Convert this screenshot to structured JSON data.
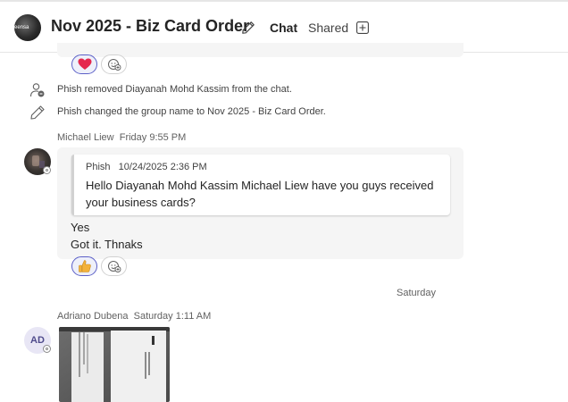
{
  "header": {
    "group_avatar_text": "eensa",
    "title": "Nov 2025 - Biz Card Order",
    "tabs": [
      {
        "label": "Chat",
        "active": true
      },
      {
        "label": "Shared",
        "active": false
      }
    ],
    "accent_color": "#5b5fc7"
  },
  "system_messages": [
    {
      "icon": "person-remove-icon",
      "text": "Phish removed Diayanah Mohd Kassim from the chat."
    },
    {
      "icon": "pencil-icon",
      "text": "Phish changed the group name to Nov 2025 - Biz Card Order."
    }
  ],
  "messages": [
    {
      "sender": "Michael Liew",
      "time": "Friday 9:55 PM",
      "quote": {
        "author": "Phish",
        "timestamp": "10/24/2025 2:36 PM",
        "text": "Hello Diayanah Mohd Kassim Michael Liew have you guys received your business cards?"
      },
      "lines": [
        "Yes",
        "Got it. Thnaks"
      ],
      "reaction": "thumbs-up-icon"
    },
    {
      "day_separator": "Saturday",
      "sender": "Adriano Dubena",
      "time": "Saturday 1:11 AM",
      "avatar_initials": "AD",
      "attachment": "business-card-photo"
    }
  ],
  "previous_reaction": "heart-icon"
}
